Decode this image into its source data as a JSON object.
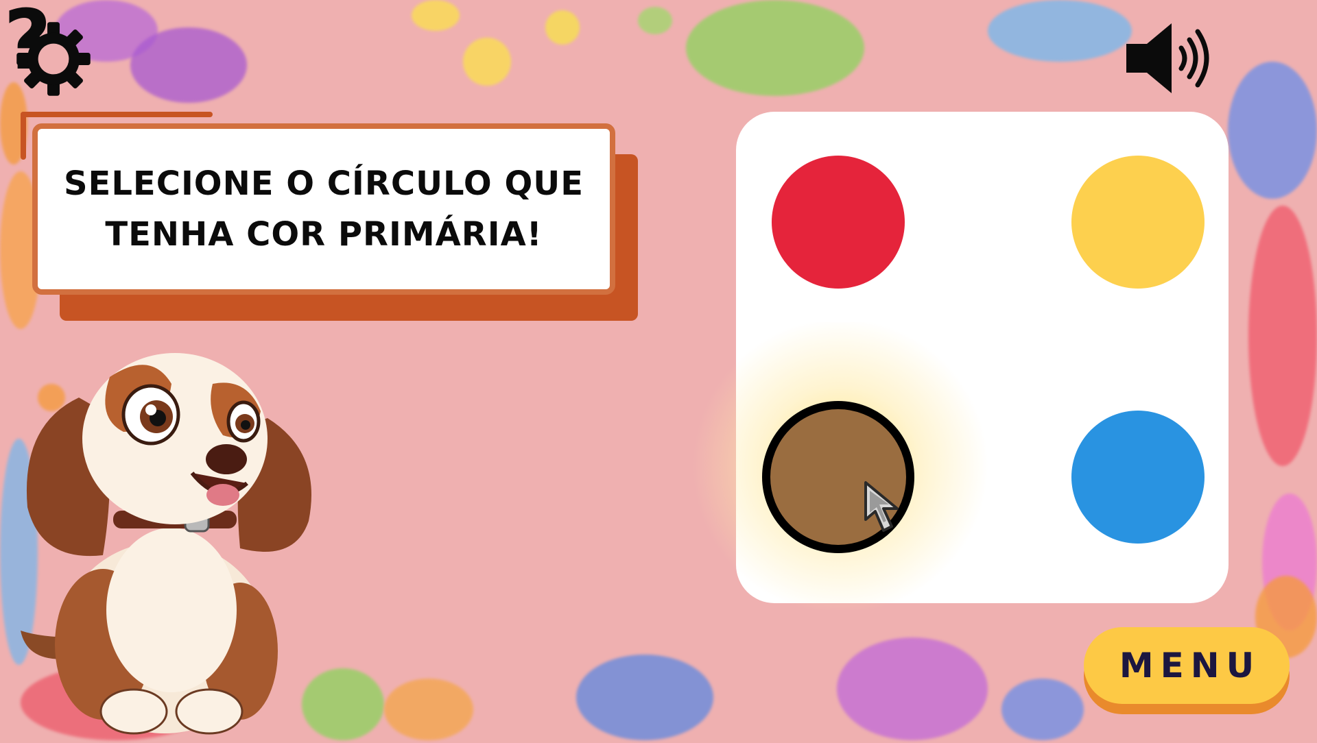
{
  "toolbar": {
    "settings_icon": "gear-icon",
    "sound_icon": "speaker-icon",
    "help_label": "?"
  },
  "question": {
    "text": "SELECIONE O CÍRCULO QUE TENHA COR PRIMÁRIA!"
  },
  "options": [
    {
      "name": "red",
      "color": "#e5243b",
      "selected": false
    },
    {
      "name": "yellow",
      "color": "#fdd04e",
      "selected": false
    },
    {
      "name": "brown",
      "color": "#9a6d40",
      "selected": true
    },
    {
      "name": "blue",
      "color": "#2993e1",
      "selected": false
    }
  ],
  "menu": {
    "label": "MENU"
  },
  "colors": {
    "background": "#efb0b0",
    "card_border": "#d2703f",
    "card_shadow": "#c75423",
    "menu_button": "#fdc945"
  }
}
